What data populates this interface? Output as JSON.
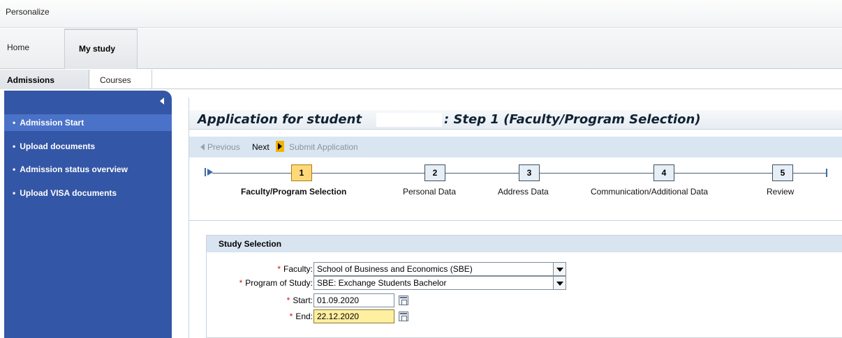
{
  "topbar": {
    "personalize": "Personalize"
  },
  "tabs": {
    "home": "Home",
    "my_study": "My study"
  },
  "subtabs": {
    "admissions": "Admissions",
    "courses": "Courses"
  },
  "sidebar": {
    "items": [
      {
        "label": "Admission Start"
      },
      {
        "label": "Upload documents"
      },
      {
        "label": "Admission status overview"
      },
      {
        "label": "Upload VISA documents"
      }
    ]
  },
  "main": {
    "title_part1": "Application for student",
    "title_part2": ": Step 1  (Faculty/Program Selection)",
    "nav": {
      "previous": "Previous",
      "next": "Next",
      "submit": "Submit Application"
    },
    "roadmap": [
      {
        "num": "1",
        "label": "Faculty/Program Selection"
      },
      {
        "num": "2",
        "label": "Personal Data"
      },
      {
        "num": "3",
        "label": "Address Data"
      },
      {
        "num": "4",
        "label": "Communication/Additional Data"
      },
      {
        "num": "5",
        "label": "Review"
      }
    ],
    "study_selection": {
      "header": "Study Selection",
      "faculty_label": "Faculty:",
      "faculty_value": "School of Business and Economics (SBE)",
      "program_label": "Program of Study:",
      "program_value": "SBE: Exchange Students Bachelor",
      "start_label": "Start:",
      "start_value": "01.09.2020",
      "end_label": "End:",
      "end_value": "22.12.2020",
      "required_marker": "*"
    }
  },
  "colors": {
    "sidebar_bg": "#3456a6",
    "sidebar_active": "#4a72c8",
    "step_active": "#ffd87a",
    "focused_input": "#ffefa1",
    "next_arrow": "#f4b300",
    "required": "#d01010"
  }
}
